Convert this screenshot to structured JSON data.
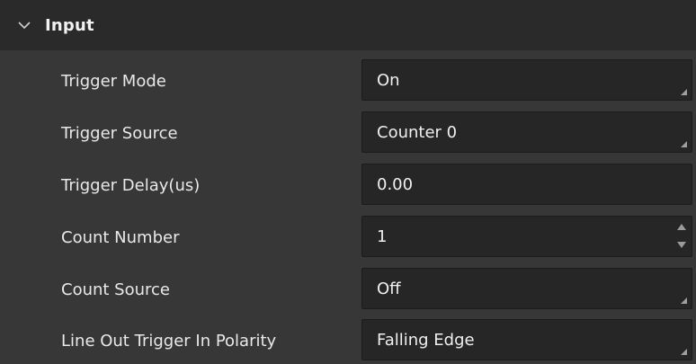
{
  "section": {
    "title": "Input",
    "expand_icon": "chevron-down-icon"
  },
  "rows": [
    {
      "label": "Trigger Mode",
      "value": "On",
      "control": "dropdown"
    },
    {
      "label": "Trigger Source",
      "value": "Counter 0",
      "control": "dropdown"
    },
    {
      "label": "Trigger Delay(us)",
      "value": "0.00",
      "control": "text-input"
    },
    {
      "label": "Count Number",
      "value": "1",
      "control": "spinbox"
    },
    {
      "label": "Count Source",
      "value": "Off",
      "control": "dropdown"
    },
    {
      "label": "Line Out Trigger In Polarity",
      "value": "Falling Edge",
      "control": "dropdown"
    }
  ],
  "colors": {
    "panel_bg": "#373737",
    "header_bg": "#2a2a2a",
    "field_bg": "#262626",
    "text": "#e9e9e9"
  }
}
